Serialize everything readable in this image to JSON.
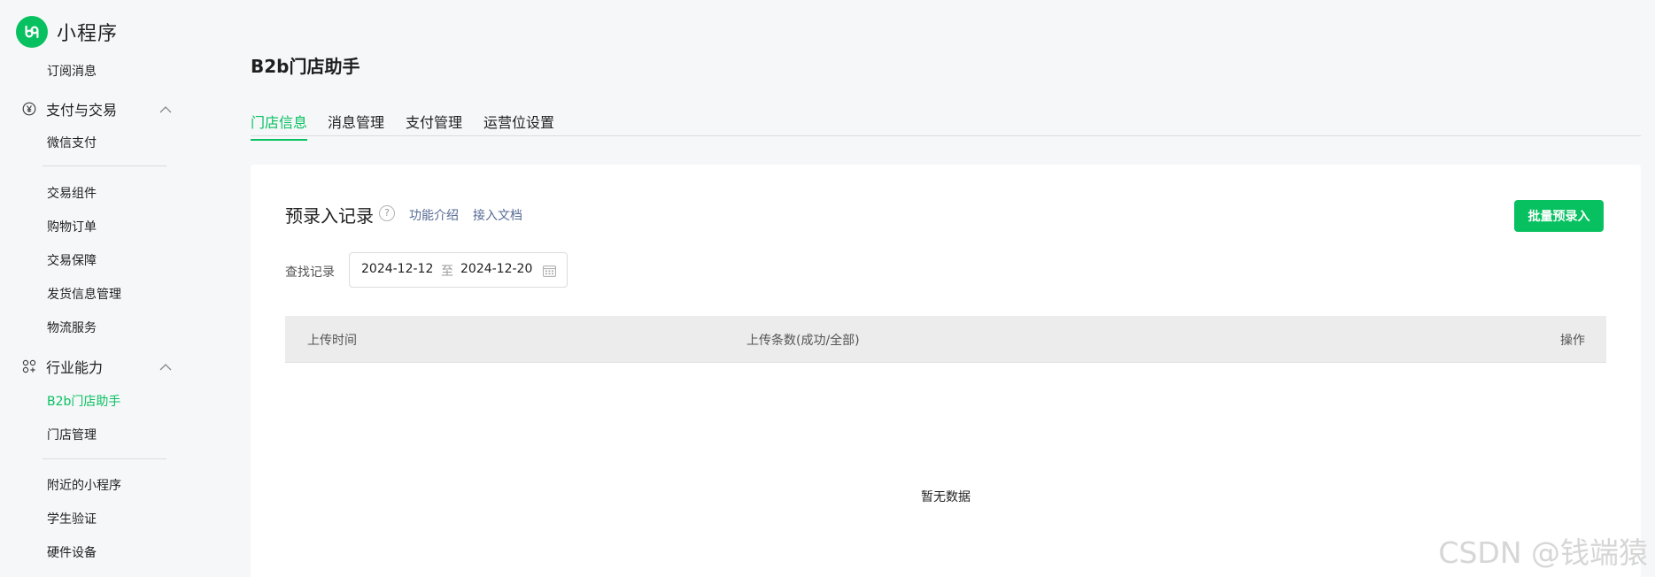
{
  "brand": {
    "title": "小程序",
    "logo_icon": "mini-program-logo-icon",
    "color": "#07c160"
  },
  "sidebar": {
    "items": [
      {
        "label": "订阅消息"
      },
      {
        "label": "支付与交易",
        "icon": "yen-circle-icon"
      },
      {
        "label": "微信支付"
      },
      {
        "label": "交易组件"
      },
      {
        "label": "购物订单"
      },
      {
        "label": "交易保障"
      },
      {
        "label": "发货信息管理"
      },
      {
        "label": "物流服务"
      },
      {
        "label": "行业能力",
        "icon": "industry-icon"
      },
      {
        "label": "B2b门店助手",
        "active": true
      },
      {
        "label": "门店管理"
      },
      {
        "label": "附近的小程序"
      },
      {
        "label": "学生验证"
      },
      {
        "label": "硬件设备"
      }
    ]
  },
  "main": {
    "title": "B2b门店助手",
    "tabs": [
      {
        "label": "门店信息",
        "active": true
      },
      {
        "label": "消息管理"
      },
      {
        "label": "支付管理"
      },
      {
        "label": "运营位设置"
      }
    ],
    "section": {
      "title": "预录入记录",
      "help": "?",
      "link_intro": "功能介绍",
      "link_docs": "接入文档",
      "primary_button": "批量预录入"
    },
    "filter": {
      "label": "查找记录",
      "start_date": "2024-12-12",
      "separator": "至",
      "end_date": "2024-12-20"
    },
    "table": {
      "columns": [
        "上传时间",
        "上传条数(成功/全部)",
        "操作"
      ],
      "empty_text": "暂无数据"
    }
  },
  "watermark": "CSDN @钱端猿",
  "colors": {
    "accent": "#07c160",
    "link": "#576b95",
    "table_header": "#ececec"
  }
}
